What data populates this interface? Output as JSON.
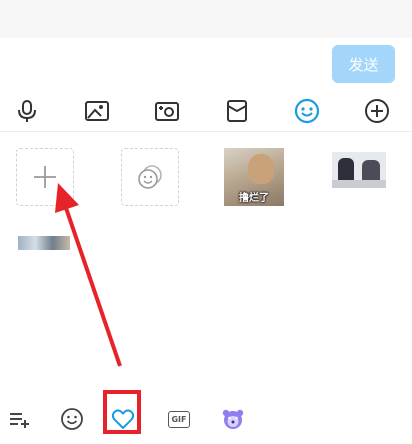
{
  "composer": {
    "send_label": "发送"
  },
  "toolbar": {
    "items": [
      "microphone-icon",
      "image-icon",
      "camera-icon",
      "red-packet-icon",
      "emoji-icon",
      "plus-icon"
    ],
    "active_color": "#1a9ce0"
  },
  "sticker_panel": {
    "add_tile": "plus-icon",
    "favorites_tile": "favorite-sticker-icon",
    "stickers": [
      {
        "caption": "撸烂了"
      },
      {
        "caption": ""
      },
      {
        "caption": ""
      }
    ]
  },
  "bottom_bar": {
    "items": [
      "manage-icon",
      "emoji-icon",
      "heart-icon",
      "gif-icon",
      "bear-icon"
    ],
    "gif_label": "GIF",
    "selected": "heart-icon"
  },
  "annotation": {
    "highlight_color": "#e52329"
  }
}
